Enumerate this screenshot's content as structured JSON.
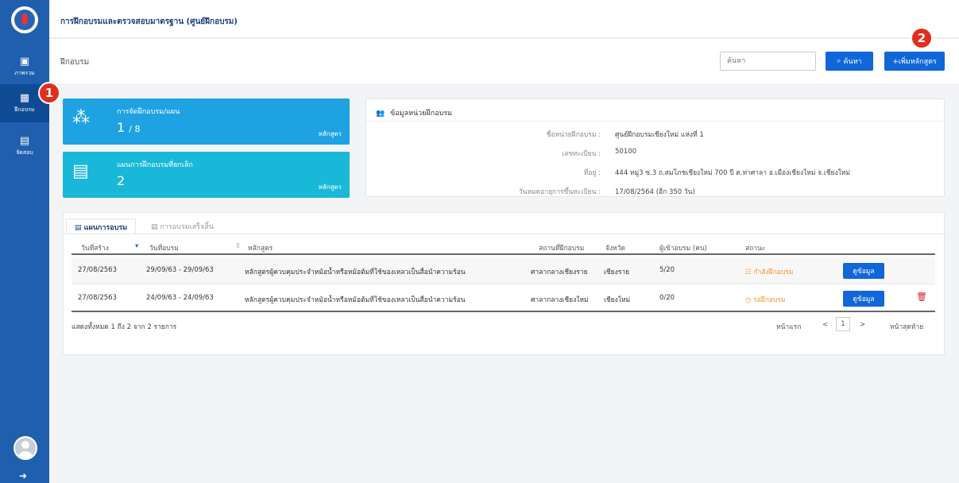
{
  "app": {
    "title": "การฝึกอบรมและตรวจสอบมาตรฐาน (ศูนย์ฝึกอบรม)"
  },
  "sidebar": {
    "items": [
      {
        "label": "ภาพรวม",
        "icon": "monitor-icon"
      },
      {
        "label": "ฝึกอบรม",
        "icon": "grid-icon"
      },
      {
        "label": "จัดสอบ",
        "icon": "building-icon"
      }
    ]
  },
  "breadcrumb": "ฝึกอบรม",
  "search": {
    "placeholder": "ค้นหา",
    "button_label": "ค้นหา"
  },
  "add_course_label": "+เพิ่มหลักสูตร",
  "badges": [
    "1",
    "2"
  ],
  "stats": [
    {
      "title": "การจัดฝึกอบรม/แผน",
      "value": "1",
      "total": "/ 8",
      "unit": "หลักสูตร"
    },
    {
      "title": "แผนการฝึกอบรมที่ยกเลิก",
      "value": "2",
      "unit": "หลักสูตร"
    }
  ],
  "unit_info": {
    "title": "ข้อมูลหน่วยฝึกอบรม",
    "rows": [
      {
        "label": "ชื่อหน่วยฝึกอบรม :",
        "value": "ศูนย์ฝึกอบรมเชียงใหม่ แห่งที่ 1"
      },
      {
        "label": "เลขทะเบียน :",
        "value": "50100"
      },
      {
        "label": "ที่อยู่ :",
        "value": "444 หมู่3 ซ.3 ถ.สมโภชเชียงใหม่ 700 ปี ต.ท่าศาลา อ.เมืองเชียงใหม่ จ.เชียงใหม่"
      },
      {
        "label": "วันหมดอายุการขึ้นทะเบียน :",
        "value": "17/08/2564 (อีก 350 วัน)"
      }
    ]
  },
  "tabs": [
    {
      "label": "แผนการอบรม",
      "active": true
    },
    {
      "label": "การอบรมเสร็จสิ้น",
      "active": false
    }
  ],
  "table": {
    "headers": [
      "วันที่สร้าง",
      "วันที่อบรม",
      "หลักสูตร",
      "สถานที่ฝึกอบรม",
      "จังหวัด",
      "ผู้เข้าอบรม (คน)",
      "สถานะ"
    ],
    "rows": [
      {
        "created": "27/08/2563",
        "training_date": "29/09/63 - 29/09/63",
        "course": "หลักสูตรผู้ควบคุมประจำหม้อน้ำหรือหม้อต้มที่ใช้ของเหลวเป็นสื่อนำความร้อน",
        "venue": "ศาลากลางเชียงราย",
        "province": "เชียงราย",
        "attendees": "5/20",
        "status": "กำลังฝึกอบรม",
        "action": "ดูข้อมูล"
      },
      {
        "created": "27/08/2563",
        "training_date": "24/09/63 - 24/09/63",
        "course": "หลักสูตรผู้ควบคุมประจำหม้อน้ำหรือหม้อต้มที่ใช้ของเหลวเป็นสื่อนำความร้อน",
        "venue": "ศาลากลางเชียงใหม่",
        "province": "เชียงใหม่",
        "attendees": "0/20",
        "status": "รอฝึกอบรม",
        "action": "ดูข้อมูล"
      }
    ],
    "summary": "แสดงทั้งหมด 1 ถึง 2 จาก 2 รายการ"
  },
  "pagination": {
    "first": "หน้าแรก",
    "prev": "<",
    "page": "1",
    "next": ">",
    "last": "หน้าสุดท้าย"
  },
  "colors": {
    "sidebar": "#1f5fae",
    "primary": "#1166d8",
    "card_blue": "#1fa2e2",
    "card_cyan": "#1ab8d8",
    "status_orange": "#f09434",
    "badge": "#e02e1f"
  }
}
